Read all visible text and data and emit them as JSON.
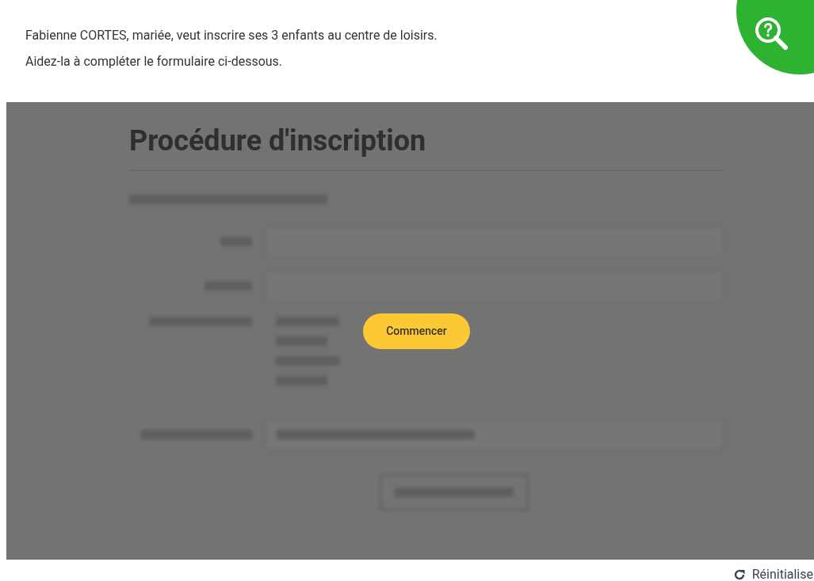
{
  "instructions": [
    "Fabienne CORTES, mariée, veut inscrire ses 3 enfants au centre de loisirs.",
    "Aidez-la à compléter le formulaire ci-dessous."
  ],
  "preview": {
    "title": "Procédure d'inscription"
  },
  "start_button": {
    "label": "Commencer"
  },
  "reset": {
    "label": "Réinitialise"
  }
}
